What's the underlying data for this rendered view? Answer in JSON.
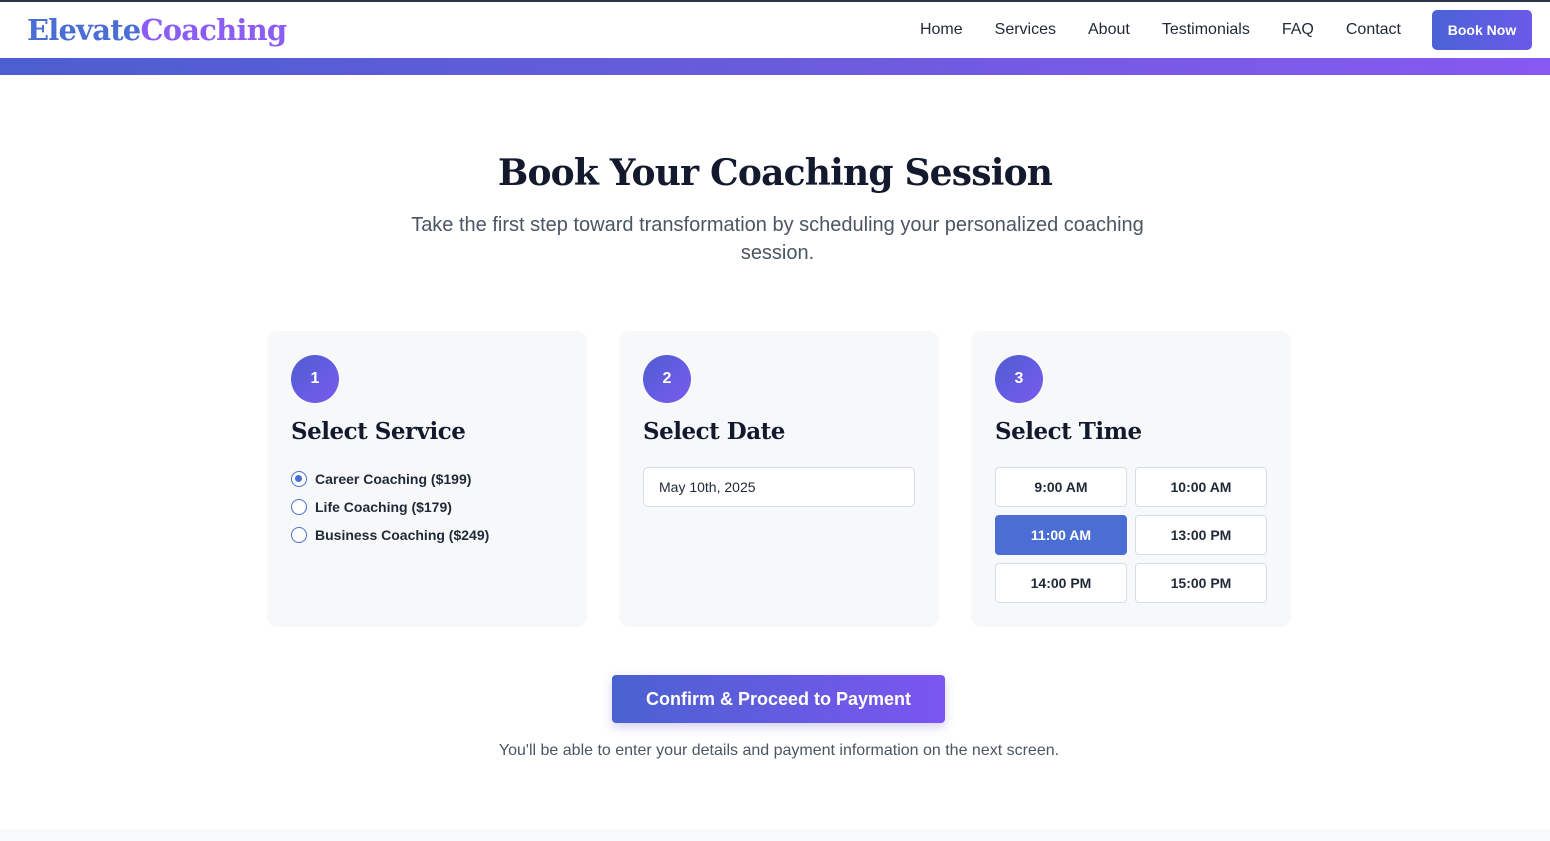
{
  "brand": {
    "logo_part1": "Elevate",
    "logo_part2": "Coaching"
  },
  "nav": {
    "items": [
      {
        "label": "Home"
      },
      {
        "label": "Services"
      },
      {
        "label": "About"
      },
      {
        "label": "Testimonials"
      },
      {
        "label": "FAQ"
      },
      {
        "label": "Contact"
      }
    ],
    "cta_label": "Book Now"
  },
  "hero": {
    "title": "Book Your Coaching Session",
    "subtitle": "Take the first step toward transformation by scheduling your personalized coaching session."
  },
  "steps": [
    {
      "number": "1",
      "title": "Select Service",
      "options": [
        {
          "label": "Career Coaching ($199)",
          "selected": true
        },
        {
          "label": "Life Coaching ($179)",
          "selected": false
        },
        {
          "label": "Business Coaching ($249)",
          "selected": false
        }
      ]
    },
    {
      "number": "2",
      "title": "Select Date",
      "date_value": "May 10th, 2025"
    },
    {
      "number": "3",
      "title": "Select Time",
      "slots": [
        {
          "label": "9:00 AM",
          "selected": false
        },
        {
          "label": "10:00 AM",
          "selected": false
        },
        {
          "label": "11:00 AM",
          "selected": true
        },
        {
          "label": "13:00 PM",
          "selected": false
        },
        {
          "label": "14:00 PM",
          "selected": false
        },
        {
          "label": "15:00 PM",
          "selected": false
        }
      ]
    }
  ],
  "confirm": {
    "button_label": "Confirm & Proceed to Payment",
    "note": "You'll be able to enter your details and payment information on the next screen."
  },
  "colors": {
    "accent": "#4a6ed4",
    "accent_purple": "#8b5cf6",
    "card_background": "#f7f8fa",
    "heading": "#141a2e"
  }
}
